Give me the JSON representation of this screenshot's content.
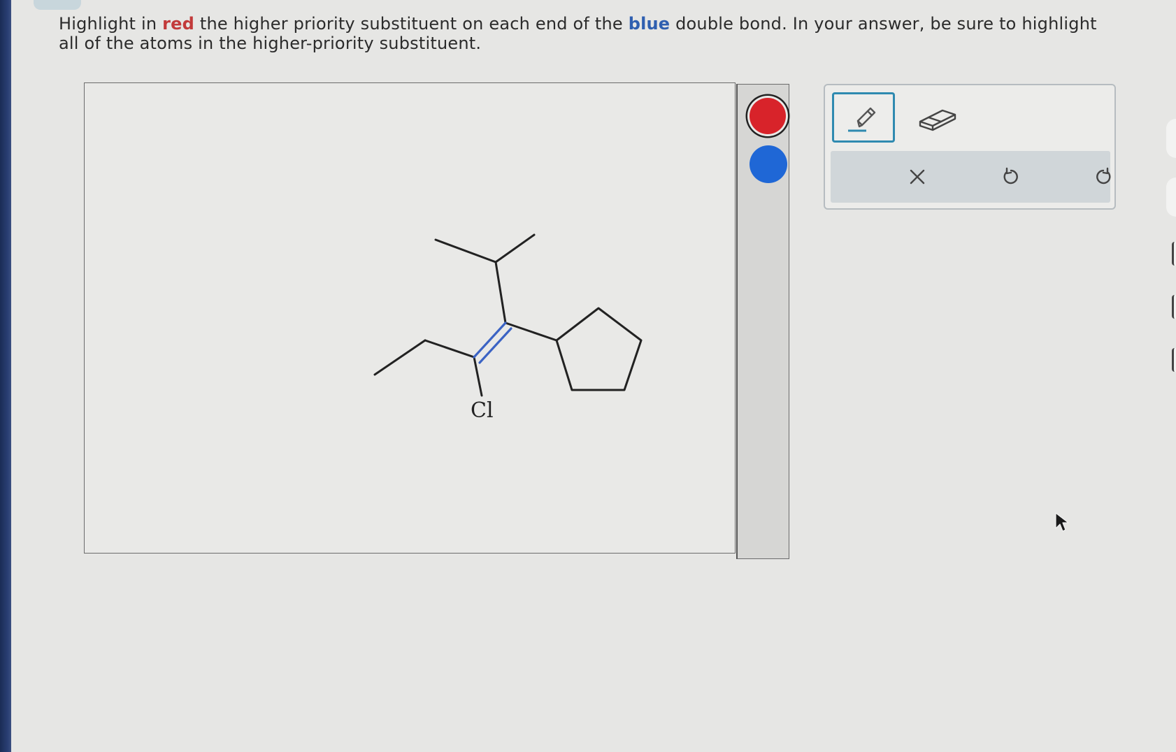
{
  "question": {
    "part1": "Highlight in ",
    "red_word": "red",
    "part2": " the higher priority substituent on each end of the ",
    "blue_word": "blue",
    "part3": " double bond. In your answer, be sure to highlight all of the atoms in the higher-priority substituent."
  },
  "molecule": {
    "atom_label": "Cl",
    "double_bond_color": "#3b63c4"
  },
  "palette": {
    "colors": [
      "#d8232a",
      "#1f67d6"
    ],
    "selected": "red"
  },
  "toolbar": {
    "tools": [
      "pencil-icon",
      "eraser-icon"
    ],
    "active_tool": "pencil",
    "actions": [
      "clear-icon",
      "undo-icon",
      "redo-icon"
    ]
  }
}
